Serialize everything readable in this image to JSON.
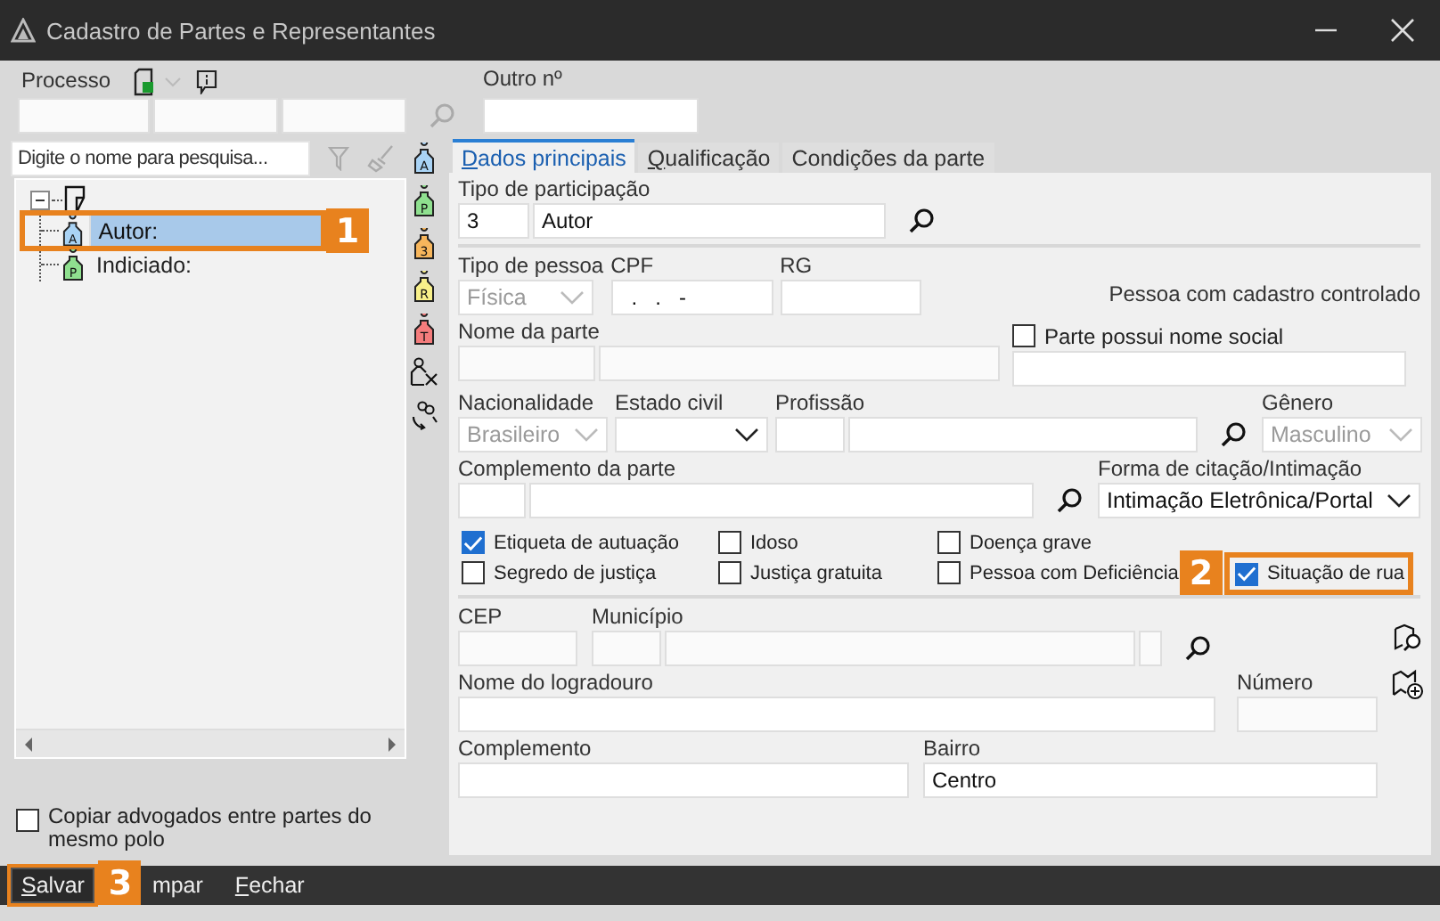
{
  "window": {
    "title": "Cadastro de Partes e Representantes"
  },
  "processo": {
    "label": "Processo",
    "outro_label": "Outro nº"
  },
  "search": {
    "placeholder": "Digite o nome para pesquisa..."
  },
  "tree": [
    {
      "expanded": true,
      "children": [
        {
          "label": "Autor:",
          "selected": true,
          "icon_letter": "A",
          "color": "#a9d3f5",
          "callout": "1"
        },
        {
          "label": "Indiciado:",
          "selected": false,
          "icon_letter": "P",
          "color": "#8fe08f"
        }
      ]
    }
  ],
  "side_tools": [
    {
      "kind": "tag",
      "letter": "A",
      "color": "#a9d3f5"
    },
    {
      "kind": "tag",
      "letter": "P",
      "color": "#8fe08f"
    },
    {
      "kind": "tag",
      "letter": "3",
      "color": "#f7b65c"
    },
    {
      "kind": "tag",
      "letter": "R",
      "color": "#f8f08a"
    },
    {
      "kind": "tag",
      "letter": "T",
      "color": "#f47c7c"
    },
    {
      "kind": "remove"
    },
    {
      "kind": "swap"
    }
  ],
  "tabs": [
    {
      "label": "Dados principais",
      "selected": true,
      "mnemonic": true
    },
    {
      "label": "Qualificação",
      "selected": false,
      "mnemonic": true
    },
    {
      "label": "Condições da parte",
      "selected": false,
      "mnemonic": false
    }
  ],
  "tipo_participacao": {
    "label": "Tipo de participação",
    "code": "3",
    "value": "Autor"
  },
  "tipo_pessoa": {
    "label": "Tipo de pessoa",
    "value": "Física",
    "disabled": true
  },
  "cpf": {
    "label": "CPF",
    "value": "  .   .   -"
  },
  "rg": {
    "label": "RG"
  },
  "cadastro_note": "Pessoa com cadastro controlado",
  "nome_parte": {
    "label": "Nome da parte"
  },
  "nome_social": {
    "label": "Parte possui nome social",
    "checked": false
  },
  "nacionalidade": {
    "label": "Nacionalidade",
    "value": "Brasileiro",
    "disabled": true
  },
  "estado_civil": {
    "label": "Estado civil",
    "disabled": false
  },
  "profissao": {
    "label": "Profissão"
  },
  "genero": {
    "label": "Gênero",
    "value": "Masculino",
    "disabled": true
  },
  "complemento_parte": {
    "label": "Complemento da parte"
  },
  "forma_citacao": {
    "label": "Forma de citação/Intimação",
    "value": "Intimação Eletrônica/Portal",
    "disabled": false
  },
  "flag_rows": [
    [
      {
        "label": "Etiqueta de autuação",
        "checked": true
      },
      {
        "label": "Idoso",
        "checked": false
      },
      {
        "label": "Doença grave",
        "checked": false
      }
    ],
    [
      {
        "label": "Segredo de justiça",
        "checked": false
      },
      {
        "label": "Justiça gratuita",
        "checked": false
      },
      {
        "label": "Pessoa com Deficiência",
        "checked": false
      },
      {
        "label": "Situação de rua",
        "checked": true,
        "callout": "2"
      }
    ]
  ],
  "endereco": {
    "cep_label": "CEP",
    "municipio_label": "Município",
    "logradouro_label": "Nome do logradouro",
    "numero_label": "Número",
    "complemento_label": "Complemento",
    "bairro_label": "Bairro",
    "bairro": "Centro"
  },
  "copy_lawyers": {
    "label": "Copiar advogados entre partes do mesmo polo",
    "checked": false
  },
  "buttons": [
    {
      "label": "Salvar",
      "mnemonic": true,
      "callout": "3"
    },
    {
      "label": "mpar",
      "mnemonic": false
    },
    {
      "label": "Fechar",
      "mnemonic": true
    }
  ]
}
